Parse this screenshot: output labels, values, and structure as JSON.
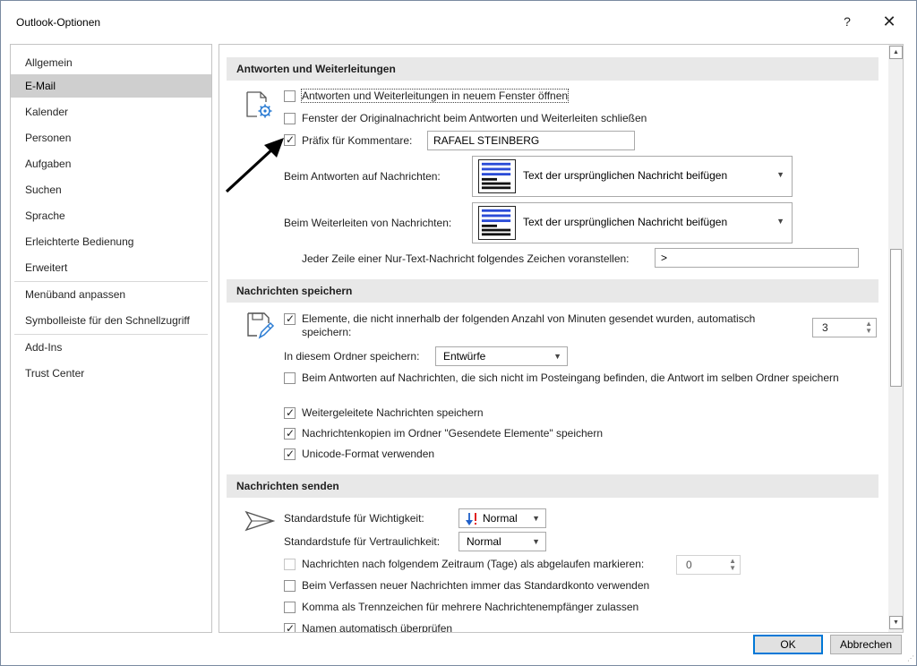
{
  "window": {
    "title": "Outlook-Optionen",
    "help_label": "?",
    "close_label": "✕"
  },
  "sidebar": {
    "items": [
      {
        "label": "Allgemein"
      },
      {
        "label": "E-Mail",
        "selected": true
      },
      {
        "label": "Kalender"
      },
      {
        "label": "Personen"
      },
      {
        "label": "Aufgaben"
      },
      {
        "label": "Suchen"
      },
      {
        "label": "Sprache"
      },
      {
        "label": "Erleichterte Bedienung"
      },
      {
        "label": "Erweitert"
      },
      {
        "label": "Menüband anpassen"
      },
      {
        "label": "Symbolleiste für den Schnellzugriff"
      },
      {
        "label": "Add-Ins"
      },
      {
        "label": "Trust Center"
      }
    ]
  },
  "sections": {
    "replies": {
      "title": "Antworten und Weiterleitungen",
      "open_new_window": {
        "label": "Antworten und Weiterleitungen in neuem Fenster öffnen",
        "checked": false
      },
      "close_original": {
        "label": "Fenster der Originalnachricht beim Antworten und Weiterleiten schließen",
        "checked": false
      },
      "prefix": {
        "label": "Präfix für Kommentare:",
        "checked": true,
        "value": "RAFAEL STEINBERG"
      },
      "reply_label": "Beim Antworten auf Nachrichten:",
      "reply_value": "Text der ursprünglichen Nachricht beifügen",
      "forward_label": "Beim Weiterleiten von Nachrichten:",
      "forward_value": "Text der ursprünglichen Nachricht beifügen",
      "prefix_char_label": "Jeder Zeile einer Nur-Text-Nachricht folgendes Zeichen voranstellen:",
      "prefix_char_value": ">"
    },
    "save": {
      "title": "Nachrichten speichern",
      "autosave": {
        "label": "Elemente, die nicht innerhalb der folgenden Anzahl von Minuten gesendet wurden, automatisch speichern:",
        "checked": true,
        "minutes": "3"
      },
      "folder_label": "In diesem Ordner speichern:",
      "folder_value": "Entwürfe",
      "reply_same_folder": {
        "label": "Beim Antworten auf Nachrichten, die sich nicht im Posteingang befinden, die Antwort im selben Ordner speichern",
        "checked": false
      },
      "save_forwarded": {
        "label": "Weitergeleitete Nachrichten speichern",
        "checked": true
      },
      "save_copies": {
        "label": "Nachrichtenkopien im Ordner \"Gesendete Elemente\" speichern",
        "checked": true
      },
      "unicode": {
        "label": "Unicode-Format verwenden",
        "checked": true
      }
    },
    "send": {
      "title": "Nachrichten senden",
      "importance_label": "Standardstufe für Wichtigkeit:",
      "importance_value": "Normal",
      "sensitivity_label": "Standardstufe für Vertraulichkeit:",
      "sensitivity_value": "Normal",
      "expire": {
        "label": "Nachrichten nach folgendem Zeitraum (Tage) als abgelaufen markieren:",
        "checked": false,
        "days": "0"
      },
      "default_account": {
        "label": "Beim Verfassen neuer Nachrichten immer das Standardkonto verwenden",
        "checked": false
      },
      "comma_separator": {
        "label": "Komma als Trennzeichen für mehrere Nachrichtenempfänger zulassen",
        "checked": false
      },
      "check_names": {
        "label": "Namen automatisch überprüfen",
        "checked": true
      }
    }
  },
  "buttons": {
    "ok": "OK",
    "cancel": "Abbrechen"
  },
  "colors": {
    "accent": "#0078d7",
    "selected_nav": "#cfcfcf",
    "section_header": "#e8e8e8",
    "importance_icon": "#1e5fc9"
  },
  "icons": [
    "reply-settings-icon",
    "save-icon",
    "send-icon",
    "annotation-arrow-icon",
    "importance-arrow-icon"
  ]
}
